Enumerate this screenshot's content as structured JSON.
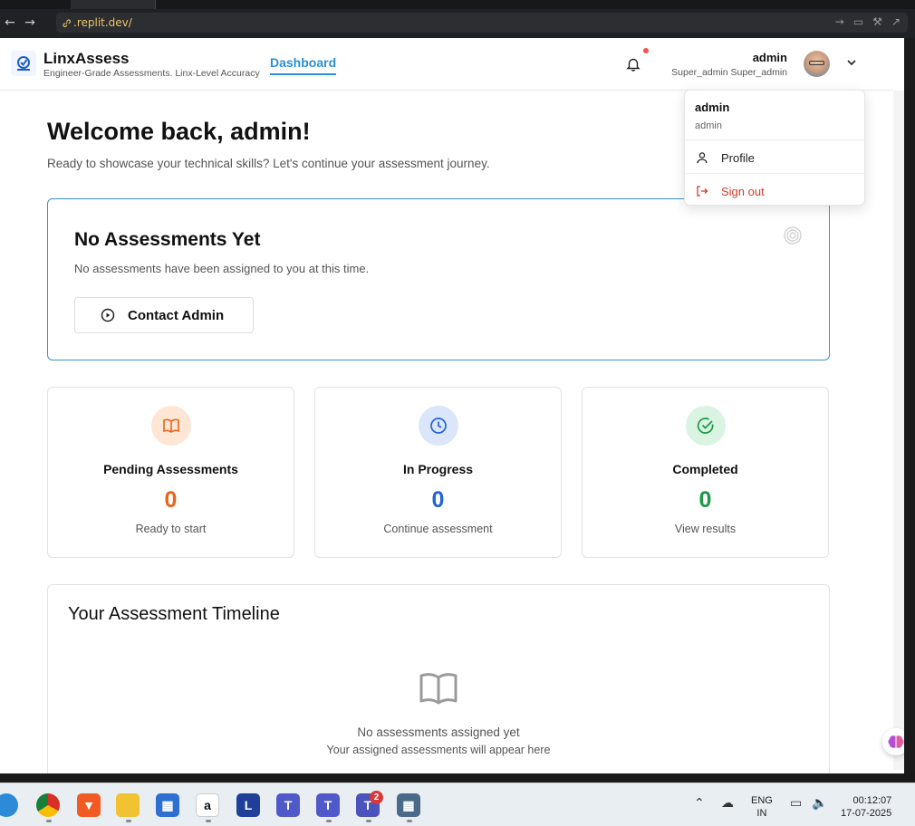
{
  "browser": {
    "url": ".replit.dev/",
    "back_glyph": "←",
    "forward_glyph": "→",
    "reload_glyph": "⟳"
  },
  "header": {
    "brand_name": "LinxAssess",
    "tagline": "Engineer-Grade Assessments. Linx-Level Accuracy",
    "nav_dashboard": "Dashboard",
    "user_name": "admin",
    "user_role": "Super_admin Super_admin"
  },
  "dropdown": {
    "name": "admin",
    "sub": "admin",
    "profile": "Profile",
    "signout": "Sign out"
  },
  "welcome": {
    "title": "Welcome back, admin!",
    "subtitle": "Ready to showcase your technical skills? Let's continue your assessment journey."
  },
  "empty": {
    "title": "No Assessments Yet",
    "desc": "No assessments have been assigned to you at this time.",
    "button": "Contact Admin"
  },
  "stats": [
    {
      "label": "Pending Assessments",
      "value": "0",
      "sub": "Ready to start",
      "color": "#e8651c",
      "bg": "#fde6d4",
      "icon": "book-open-icon"
    },
    {
      "label": "In Progress",
      "value": "0",
      "sub": "Continue assessment",
      "color": "#2463d6",
      "bg": "#dbe6fb",
      "icon": "clock-icon"
    },
    {
      "label": "Completed",
      "value": "0",
      "sub": "View results",
      "color": "#1a9a46",
      "bg": "#d9f4e2",
      "icon": "check-circle-icon"
    }
  ],
  "timeline": {
    "title": "Your Assessment Timeline",
    "empty": "No assessments assigned yet",
    "empty_sub": "Your assigned assessments will appear here"
  },
  "taskbar": {
    "teams_badge": "2",
    "lang1": "ENG",
    "lang2": "IN",
    "time": "00:12:07",
    "date": "17-07-2025",
    "l_app": "L"
  },
  "colors": {
    "accent": "#2b8fd6",
    "card_border": "#3b93c6",
    "danger": "#d23b2f"
  }
}
